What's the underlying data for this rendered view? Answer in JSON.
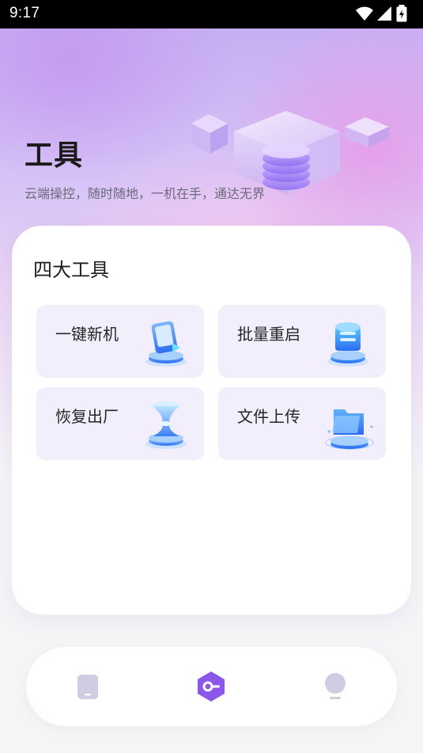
{
  "status_bar": {
    "time": "9:17",
    "icons": [
      "wifi-icon",
      "signal-icon",
      "battery-charging-icon"
    ]
  },
  "header": {
    "title": "工具",
    "subtitle": "云端操控，随时随地，一机在手，通达无界"
  },
  "tools_section": {
    "title": "四大工具",
    "items": [
      {
        "label": "一键新机",
        "icon": "phone-reset-icon",
        "highlighted": false
      },
      {
        "label": "批量重启",
        "icon": "batch-restart-icon",
        "highlighted": true
      },
      {
        "label": "恢复出厂",
        "icon": "hourglass-icon",
        "highlighted": true
      },
      {
        "label": "文件上传",
        "icon": "folder-upload-icon",
        "highlighted": false
      }
    ]
  },
  "bottom_nav": {
    "items": [
      {
        "icon": "phone-icon",
        "active": false
      },
      {
        "icon": "tools-icon",
        "active": true
      },
      {
        "icon": "profile-icon",
        "active": false
      }
    ],
    "active_color": "#8b57ea",
    "inactive_color": "#cfcde3"
  },
  "colors": {
    "tile_background": "#f2eefb",
    "accent": "#8b57ea",
    "icon_blue": "#3d8bff"
  }
}
